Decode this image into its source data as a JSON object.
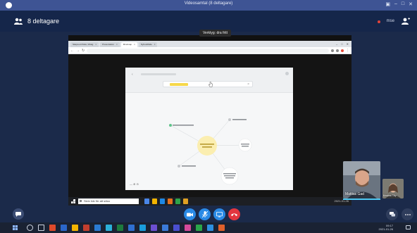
{
  "window": {
    "title": "Videosamtal (8 deltagare)",
    "accent": "#3e5494"
  },
  "header": {
    "participants_label": "8 deltagare",
    "user_label": "mse"
  },
  "share": {
    "tooltip": "Verktyg: dra fritt",
    "browser_tabs": [
      {
        "label": "Skapa ett flöde; tillväg"
      },
      {
        "label": "Presentation"
      },
      {
        "label": "Mindmap",
        "active": true
      },
      {
        "label": "Nyhetsflöde"
      }
    ]
  },
  "shared_taskbar": {
    "search_placeholder": "Skriv här för att söka",
    "tray_text": "2021-01-26"
  },
  "videos": {
    "main_name": "Mattias Gad",
    "small_name": "Kristina Tilly"
  },
  "taskbar": {
    "time": "09:17",
    "date": "2021-01-26"
  },
  "colors": {
    "call_blue": "#2a8ae6",
    "hangup_red": "#e2363f",
    "mindmap_center": "#fbeeb0",
    "highlight": "#f6d84a"
  },
  "icons": {
    "camera": "video-camera-icon",
    "mic": "microphone-muted-icon",
    "share": "screen-share-icon",
    "hangup": "hang-up-icon"
  }
}
